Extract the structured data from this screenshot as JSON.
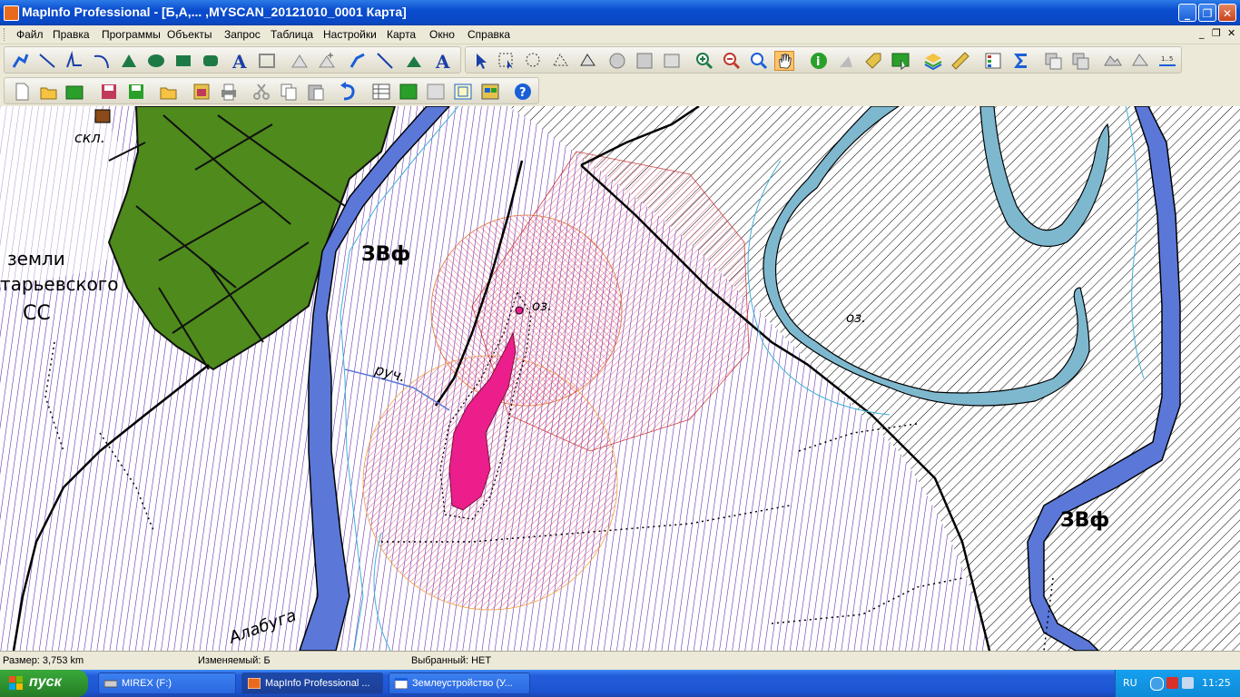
{
  "window": {
    "title": "MapInfo Professional - [Б,А,... ,MYSCAN_20121010_0001 Карта]",
    "minimize": "_",
    "maximize": "❐",
    "close": "✕"
  },
  "menu": {
    "items": [
      "Файл",
      "Правка",
      "Программы",
      "Объекты",
      "Запрос",
      "Таблица",
      "Настройки",
      "Карта",
      "Окно",
      "Справка"
    ],
    "mdi_minimize": "_",
    "mdi_restore": "❐",
    "mdi_close": "✕"
  },
  "map_labels": {
    "skl": "скл.",
    "zemli": "земли",
    "selsovet": "тарьевского",
    "ss": "СС",
    "zvf1": "ЗВф",
    "zvf2": "ЗВф",
    "oz1": "оз.",
    "oz2": "оз.",
    "ruch": "руч.",
    "alabuga": "Алабуга"
  },
  "status": {
    "size": "Размер: 3,753 km",
    "editable": "Изменяемый: Б",
    "selected": "Выбранный: НЕТ"
  },
  "taskbar": {
    "start": "пуск",
    "tasks": [
      "MIREX (F:)",
      "MapInfo Professional ...",
      "Землеустройство (У..."
    ],
    "lang": "RU",
    "clock": "11:25"
  },
  "colors": {
    "accent": "#0a4ccf",
    "forest": "#4e8a1c",
    "lake_pink": "#ec1e8c",
    "river_blue": "#5b78d8",
    "hatch_purple": "#5a1ea8",
    "hatch_black": "#000000"
  }
}
